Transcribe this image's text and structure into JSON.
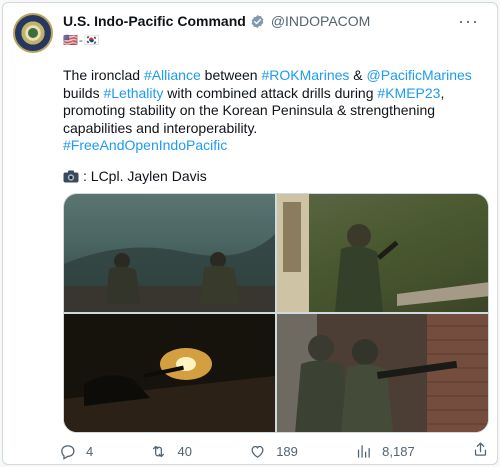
{
  "author": {
    "name": "U.S. Indo-Pacific Command",
    "handle": "@INDOPACOM",
    "flags": "🇺🇸-🇰🇷"
  },
  "tweet": {
    "seg1": "The ironclad ",
    "tag_alliance": "#Alliance",
    "seg2": " between ",
    "tag_rokmarines": "#ROKMarines",
    "seg3": " & ",
    "mention_pacificmarines": "@PacificMarines",
    "seg4": " builds ",
    "tag_lethality": "#Lethality",
    "seg5": " with combined attack drills during ",
    "tag_kmep23": "#KMEP23",
    "seg6": ", promoting stability on the Korean Peninsula & strengthening capabilities and interoperability.",
    "tag_foip": "#FreeAndOpenIndoPacific",
    "photo_credit": ": LCpl. Jaylen Davis"
  },
  "actions": {
    "replies": "4",
    "reposts": "40",
    "likes": "189",
    "views": "8,187"
  },
  "colors": {
    "link": "#1d9bf0",
    "secondary_text": "#536471",
    "border": "#cfd9de"
  }
}
